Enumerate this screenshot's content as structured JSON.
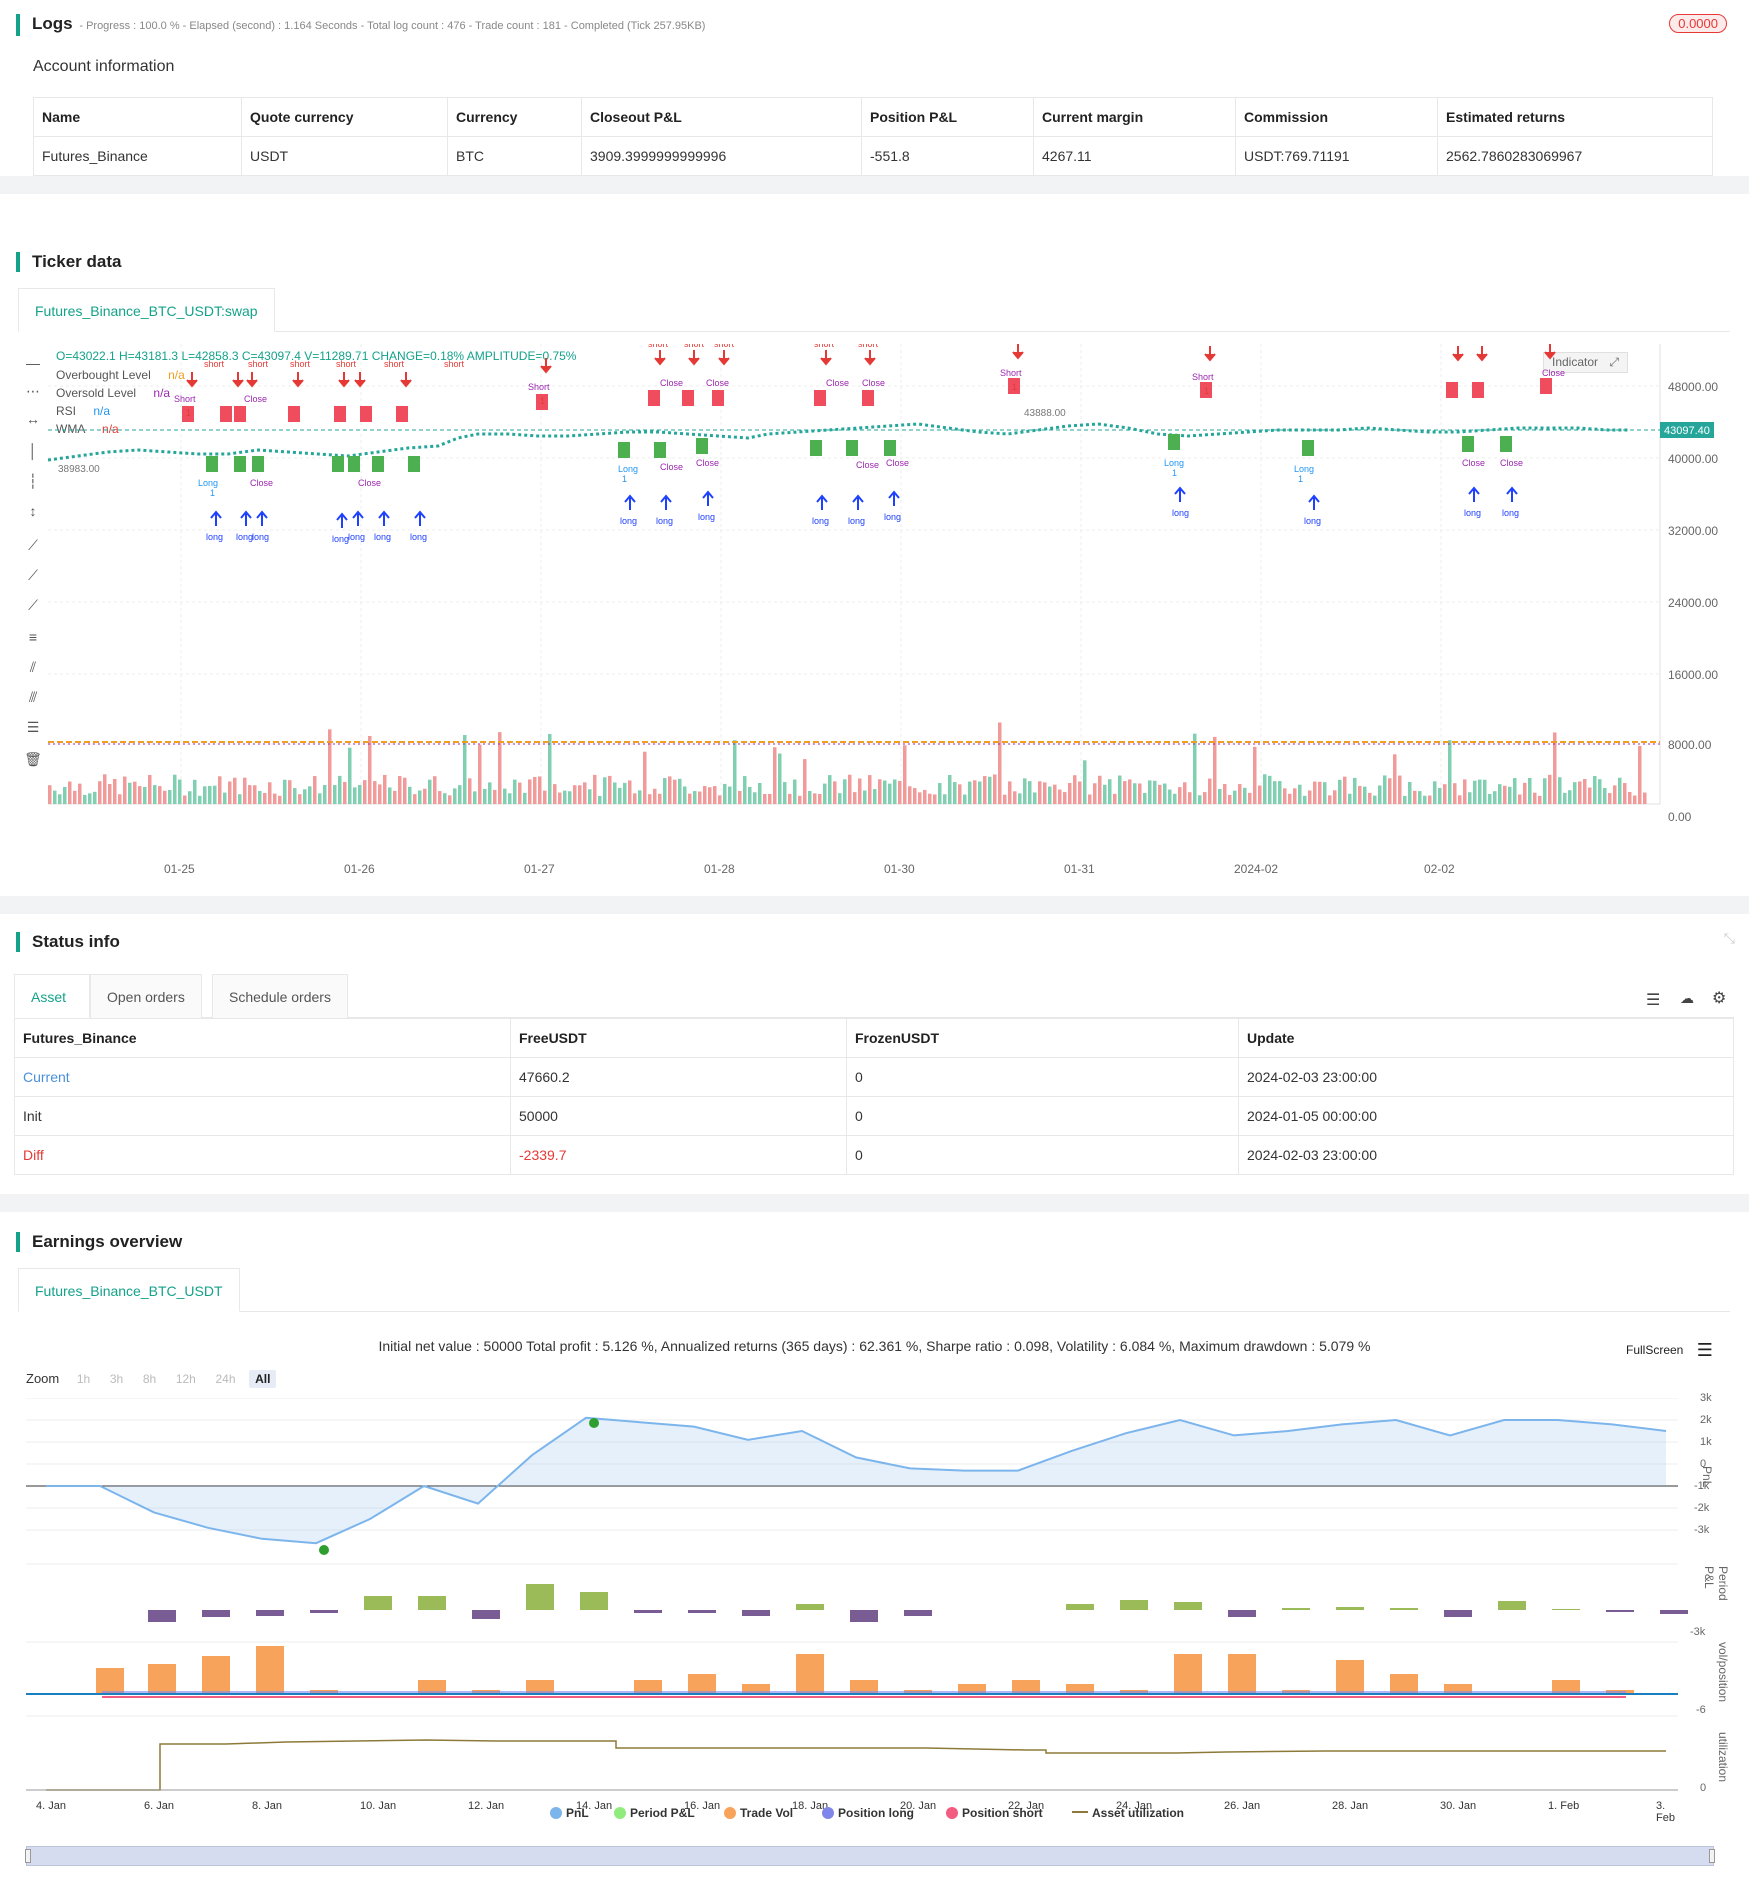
{
  "logs": {
    "title": "Logs",
    "summary": "- Progress : 100.0 % - Elapsed (second) : 1.164  Seconds - Total log count : 476 - Trade count : 181 - Completed (Tick 257.95KB)",
    "badge": "0.0000",
    "badge_color": "#e53935"
  },
  "account": {
    "title": "Account information",
    "headers": [
      "Name",
      "Quote currency",
      "Currency",
      "Closeout P&L",
      "Position P&L",
      "Current margin",
      "Commission",
      "Estimated returns"
    ],
    "row": [
      "Futures_Binance",
      "USDT",
      "BTC",
      "3909.3999999999996",
      "-551.8",
      "4267.11",
      "USDT:769.71191",
      "2562.7860283069967"
    ]
  },
  "ticker": {
    "title": "Ticker data",
    "tab": "Futures_Binance_BTC_USDT:swap",
    "ohlc": "O=43022.1 H=43181.3 L=42858.3 C=43097.4 V=11289.71 CHANGE=0.18% AMPLITUDE=0.75%",
    "legend": [
      {
        "label": "Overbought Level",
        "value": "n/a",
        "color": "#f0a020"
      },
      {
        "label": "Oversold Level",
        "value": "n/a",
        "color": "#9c27b0"
      },
      {
        "label": "RSI",
        "value": "n/a",
        "color": "#2196f3"
      },
      {
        "label": "WMA",
        "value": "n/a",
        "color": "#e53935"
      }
    ],
    "indicator_button": "Indicator",
    "price_tag": "43097.40",
    "low_label": "38983.00",
    "high_label": "43888.00",
    "y_ticks": [
      "48000.00",
      "40000.00",
      "32000.00",
      "24000.00",
      "16000.00",
      "8000.00",
      "0.00"
    ],
    "x_ticks": [
      "01-25",
      "01-26",
      "01-27",
      "01-28",
      "01-30",
      "01-31",
      "2024-02",
      "02-02"
    ],
    "short_label": "short",
    "long_label": "long",
    "short_mark": "Short",
    "long_mark": "Long",
    "close_mark": "Close",
    "one": "1"
  },
  "status": {
    "title": "Status info",
    "tabs": [
      "Asset",
      "Open orders",
      "Schedule orders"
    ],
    "headers": [
      "Futures_Binance",
      "FreeUSDT",
      "FrozenUSDT",
      "Update"
    ],
    "rows": [
      {
        "name": "Current",
        "free": "47660.2",
        "frozen": "0",
        "update": "2024-02-03 23:00:00"
      },
      {
        "name": "Init",
        "free": "50000",
        "frozen": "0",
        "update": "2024-01-05 00:00:00"
      },
      {
        "name": "Diff",
        "free": "-2339.7",
        "frozen": "0",
        "update": "2024-02-03 23:00:00"
      }
    ]
  },
  "earnings": {
    "title": "Earnings overview",
    "tab": "Futures_Binance_BTC_USDT",
    "summary": "Initial net value : 50000 Total profit : 5.126 %, Annualized returns (365 days) : 62.361 %, Sharpe ratio : 0.098, Volatility : 6.084 %, Maximum drawdown : 5.079 %",
    "fullscreen": "FullScreen",
    "zoom_label": "Zoom",
    "zoom_buttons": [
      "1h",
      "3h",
      "8h",
      "12h",
      "24h",
      "All"
    ],
    "pnl_ticks": [
      "3k",
      "2k",
      "1k",
      "0",
      "-1k",
      "-2k",
      "-3k"
    ],
    "period_ticks": [
      "-3k"
    ],
    "vol_ticks": [
      "-6"
    ],
    "util_ticks": [
      "0"
    ],
    "axis_titles": [
      "PnL",
      "Period P&L",
      "vol/position",
      "utilization"
    ],
    "x_ticks": [
      "4. Jan",
      "6. Jan",
      "8. Jan",
      "10. Jan",
      "12. Jan",
      "14. Jan",
      "16. Jan",
      "18. Jan",
      "20. Jan",
      "22. Jan",
      "24. Jan",
      "26. Jan",
      "28. Jan",
      "30. Jan",
      "1. Feb",
      "3. Feb"
    ],
    "legend": [
      {
        "label": "PnL",
        "color": "#7cb5ec"
      },
      {
        "label": "Period P&L",
        "color": "#90ed7d"
      },
      {
        "label": "Trade Vol",
        "color": "#f7a35c"
      },
      {
        "label": "Position long",
        "color": "#8085e9"
      },
      {
        "label": "Position short",
        "color": "#f15c80"
      },
      {
        "label": "Asset utilization",
        "color": "#8d7a3a"
      }
    ]
  },
  "chart_data": {
    "type": "line",
    "x": [
      "2024-01-04",
      "2024-01-05",
      "2024-01-06",
      "2024-01-07",
      "2024-01-08",
      "2024-01-09",
      "2024-01-10",
      "2024-01-11",
      "2024-01-12",
      "2024-01-13",
      "2024-01-14",
      "2024-01-15",
      "2024-01-16",
      "2024-01-17",
      "2024-01-18",
      "2024-01-19",
      "2024-01-20",
      "2024-01-21",
      "2024-01-22",
      "2024-01-23",
      "2024-01-24",
      "2024-01-25",
      "2024-01-26",
      "2024-01-27",
      "2024-01-28",
      "2024-01-29",
      "2024-01-30",
      "2024-01-31",
      "2024-02-01",
      "2024-02-02",
      "2024-02-03"
    ],
    "series": [
      {
        "name": "PnL",
        "values": [
          0,
          0,
          -1200,
          -1900,
          -2400,
          -2600,
          -1500,
          0,
          -800,
          1400,
          3100,
          2900,
          2700,
          2100,
          2500,
          1300,
          800,
          700,
          700,
          1600,
          2400,
          3000,
          2300,
          2500,
          2800,
          3000,
          2300,
          3000,
          3000,
          2800,
          2500
        ]
      }
    ],
    "ylim": [
      -3000,
      3000
    ]
  }
}
